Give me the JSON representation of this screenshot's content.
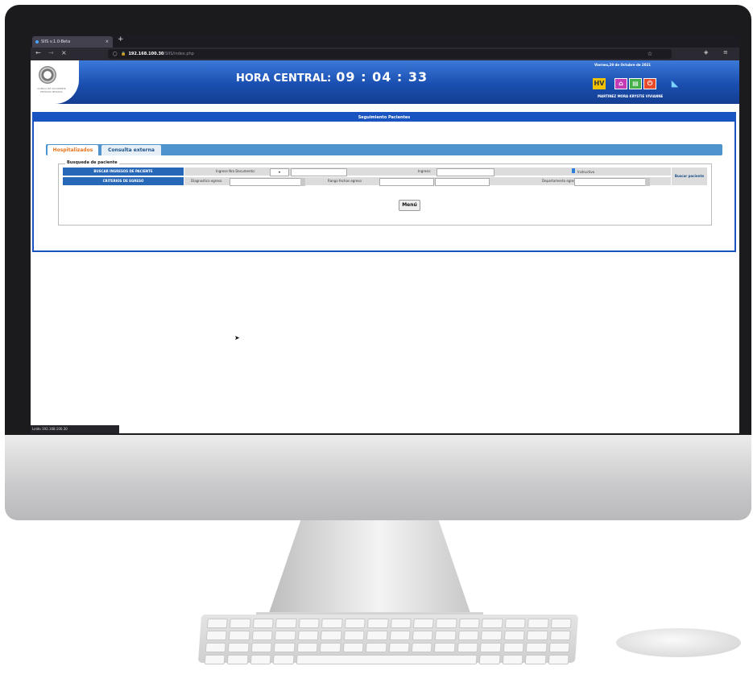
{
  "browser": {
    "tab_title": "SIIS v.1.0-Beta",
    "tab_close": "×",
    "new_tab": "+",
    "back": "←",
    "forward": "→",
    "stop": "×",
    "url_host": "192.168.100.30",
    "url_path": "/SIIS/index.php",
    "star": "☆",
    "status_text": "Leído 192.168.100.30"
  },
  "header": {
    "logo_text": "CLÍNICA DE OCCIDENTE ENTIDAD PRIVADA",
    "clock_label": "HORA CENTRAL:",
    "clock_time": "09 : 04 : 33",
    "date": "Viernes,29 de Octubre de 2021",
    "user_name": "MARTINEZ MORA KRYSTIE VIVIANNE",
    "hv_label": "HV",
    "icons": [
      "home-icon",
      "document-icon",
      "power-icon",
      "book-icon"
    ]
  },
  "panel": {
    "title": "Seguimiento Pacientes",
    "tabs": [
      "Hospitalizados",
      "Consulta externa"
    ],
    "legend": "Busqueda de paciente",
    "row1_label": "BUSCAR INGRESOS DE PACIENTE",
    "doc_label": "Ingrese Nro Documento:",
    "doc_type_arrow": "▾",
    "ingreso_label": "Ingreso:",
    "instructivo_label": "Instructivo",
    "row2_label": "CRITERIOS DE EGRESO",
    "diag_label": "Diagnostico egreso",
    "rango_label": "Rango fechas egreso",
    "depto_label": "Departamento egreso",
    "buscar_label": "Buscar paciente",
    "menu_label": "Menú"
  },
  "colors": {
    "header_blue": "#1a4fb0",
    "row_label_blue": "#2767b8",
    "active_tab_orange": "#e8731a",
    "tab_strip_blue": "#4e93cc"
  }
}
